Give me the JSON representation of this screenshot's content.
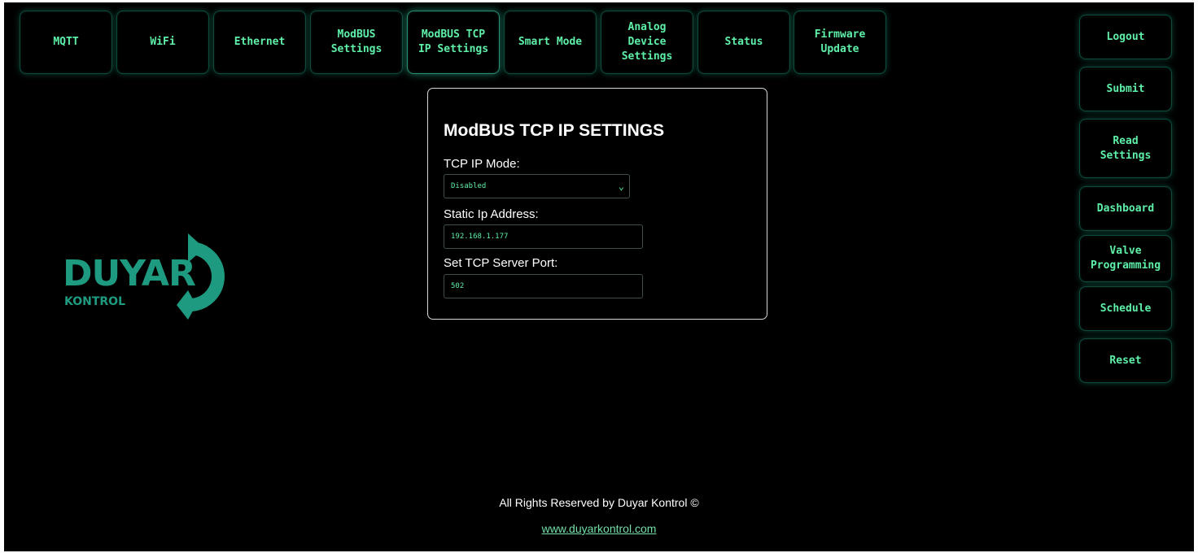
{
  "colors": {
    "background": "#000000",
    "button_text": "#5ef0a8",
    "button_border": "#0e4a3c",
    "logo": "#1e9a80",
    "link": "#74e0a8"
  },
  "nav": {
    "tabs": [
      {
        "label": "MQTT"
      },
      {
        "label": "WiFi"
      },
      {
        "label": "Ethernet"
      },
      {
        "label": "ModBUS\nSettings"
      },
      {
        "label": "ModBUS TCP\nIP Settings",
        "active": true
      },
      {
        "label": "Smart Mode"
      },
      {
        "label": "Analog\nDevice\nSettings"
      },
      {
        "label": "Status"
      },
      {
        "label": "Firmware\nUpdate"
      }
    ]
  },
  "sidebar": {
    "buttons": [
      {
        "label": "Logout"
      },
      {
        "label": "Submit"
      },
      {
        "label": "Read\nSettings"
      },
      {
        "label": "Dashboard"
      },
      {
        "label": "Valve\nProgramming"
      },
      {
        "label": "Schedule"
      },
      {
        "label": "Reset"
      }
    ]
  },
  "logo": {
    "name": "DUYAR",
    "sub": "KONTROL"
  },
  "form": {
    "title": "ModBUS TCP IP SETTINGS",
    "mode_label": "TCP IP Mode:",
    "mode_value": "Disabled",
    "ip_label": "Static Ip Address:",
    "ip_value": "192.168.1.177",
    "port_label": "Set TCP Server Port:",
    "port_value": "502",
    "icons": {
      "dropdown": "chevron-down-icon"
    }
  },
  "footer": {
    "text": "All Rights Reserved by Duyar Kontrol ©",
    "link": "www.duyarkontrol.com"
  }
}
